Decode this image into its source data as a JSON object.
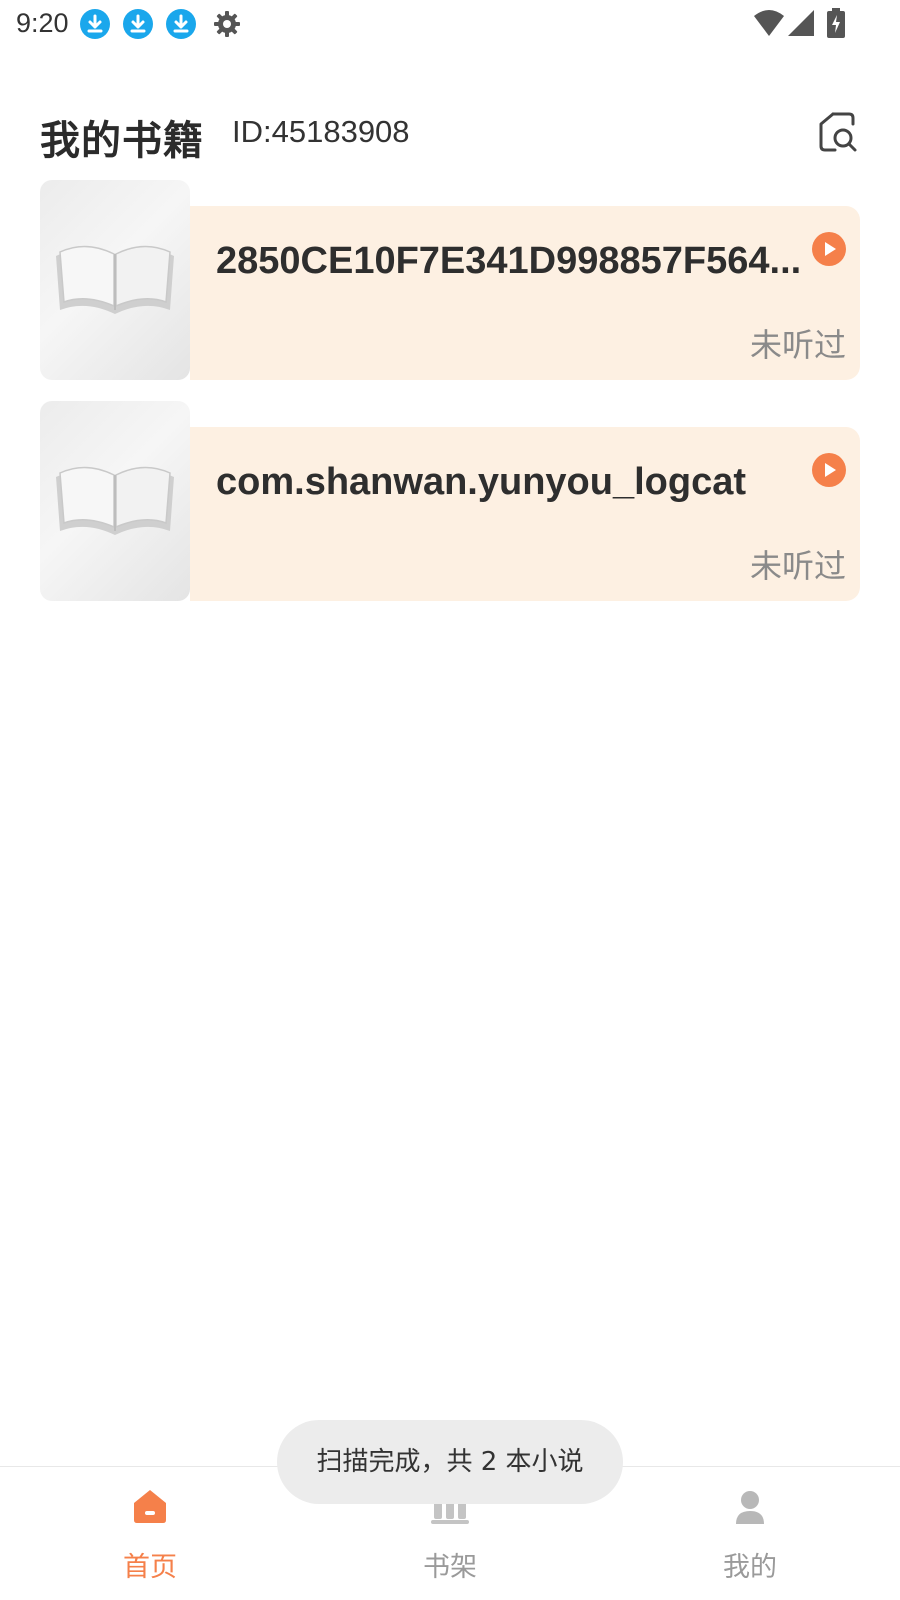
{
  "status_bar": {
    "time": "9:20",
    "notification_icons": [
      "download-icon",
      "download-icon",
      "download-icon",
      "gear-icon"
    ],
    "system_icons": [
      "wifi-icon",
      "cell-signal-icon",
      "battery-charging-icon"
    ]
  },
  "header": {
    "title": "我的书籍",
    "user_id": "ID:45183908",
    "scan_icon": "scan-search-icon"
  },
  "books": [
    {
      "title": "2850CE10F7E341D998857F564...",
      "status": "未听过"
    },
    {
      "title": "com.shanwan.yunyou_logcat",
      "status": "未听过"
    }
  ],
  "bottom_nav": {
    "items": [
      {
        "label": "首页",
        "icon": "home-icon",
        "active": true
      },
      {
        "label": "书架",
        "icon": "bookshelf-icon",
        "active": false
      },
      {
        "label": "我的",
        "icon": "user-icon",
        "active": false
      }
    ]
  },
  "toast": {
    "text": "扫描完成，共 2 本小说"
  },
  "colors": {
    "accent": "#f5804a",
    "card_background": "#fdf0e2",
    "notification_blue": "#1aa7ec",
    "muted_text": "#9a9a9a"
  }
}
